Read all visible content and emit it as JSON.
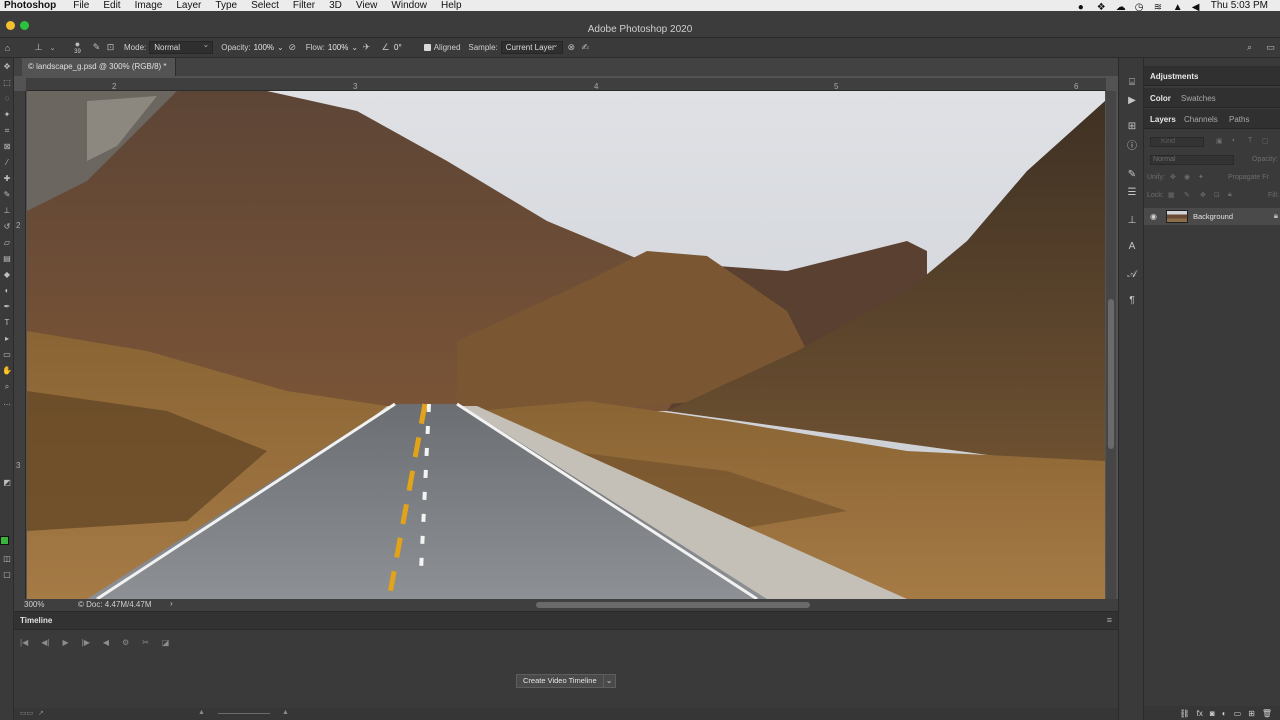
{
  "menubar": {
    "app_name": "Photoshop",
    "items": [
      "File",
      "Edit",
      "Image",
      "Layer",
      "Type",
      "Select",
      "Filter",
      "3D",
      "View",
      "Window",
      "Help"
    ],
    "clock": "Thu 5:03 PM"
  },
  "window": {
    "title": "Adobe Photoshop 2020"
  },
  "options": {
    "brush_size": "39",
    "mode_label": "Mode:",
    "mode_value": "Normal",
    "opacity_label": "Opacity:",
    "opacity_value": "100%",
    "flow_label": "Flow:",
    "flow_value": "100%",
    "angle_value": "0°",
    "aligned_label": "Aligned",
    "sample_label": "Sample:",
    "sample_value": "Current Layer"
  },
  "document": {
    "tab_label": "© landscape_g.psd @ 300% (RGB/8) *",
    "zoom": "300%",
    "doc_info": "© Doc: 4.47M/4.47M",
    "ruler_top": [
      "2",
      "3",
      "4",
      "5",
      "6"
    ],
    "ruler_left": [
      "2",
      "3"
    ]
  },
  "timeline": {
    "title": "Timeline",
    "create_button": "Create Video Timeline"
  },
  "panels": {
    "adjustments": "Adjustments",
    "color_tab": "Color",
    "swatches_tab": "Swatches",
    "layers_tab": "Layers",
    "channels_tab": "Channels",
    "paths_tab": "Paths",
    "kind_placeholder": "Kind",
    "blend_mode": "Normal",
    "opacity_label": "Opacity:",
    "unify_label": "Unify:",
    "propagate_label": "Propagate Fr",
    "lock_label": "Lock:",
    "fill_label": "Fill:",
    "layer_name": "Background"
  }
}
